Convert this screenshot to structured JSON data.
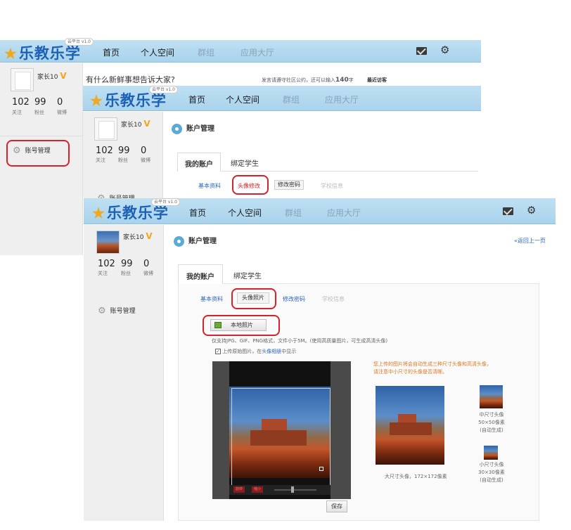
{
  "app": {
    "logo": "乐教乐学",
    "cloud_badge": "云平台 v1.0",
    "nav": [
      "首页",
      "个人空间",
      "群组",
      "应用大厅"
    ]
  },
  "user": {
    "name": "家长10",
    "vip": "V",
    "stats": [
      {
        "num": "102",
        "label": "关注"
      },
      {
        "num": "99",
        "label": "粉丝"
      },
      {
        "num": "0",
        "label": "微博"
      }
    ]
  },
  "sidebar_menu": {
    "account": "账号管理"
  },
  "layer1": {
    "status_prompt": "有什么新鲜事想告诉大家?",
    "status_notice_pre": "发言请遵守社区公约，还可以输入",
    "status_count": "140",
    "status_notice_post": "字",
    "recent_visitors": "最近访客"
  },
  "account": {
    "title": "账户管理",
    "back_link": "«返回上一页",
    "tabs": [
      "我的账户",
      "绑定学生"
    ],
    "subtabs": [
      "基本资料",
      "头像修改",
      "修改密码",
      "学校信息"
    ],
    "subtabs_final": [
      "基本资料",
      "头像照片",
      "修改密码",
      "学校信息"
    ]
  },
  "upload": {
    "local_photo": "本地照片",
    "format_hint": "仅支持JPG、GIF、PNG格式，文件小于5M。(使用高质量图片，可生成高清头像)",
    "save_original_pre": "上传原始图片，在",
    "save_original_link": "头像相册",
    "save_original_post": "中显示",
    "checkbox_checked": true,
    "notice_line1": "您上传的图片将会自动生成三种尺寸头像和高清头像，",
    "notice_line2": "请注意中小尺寸的头像是否清晰。",
    "large_caption": "大尺寸头像，172×172像素",
    "medium_caption_1": "中尺寸头像",
    "medium_caption_2": "50×50像素",
    "medium_caption_3": "(自动生成)",
    "small_caption_1": "小尺寸头像",
    "small_caption_2": "30×30像素",
    "small_caption_3": "(自动生成)",
    "crop_btn_1": "旋转",
    "crop_btn_2": "缩小",
    "save_button": "保存"
  },
  "colors": {
    "header_blue": "#a9d3ec",
    "highlight_red": "#d6222a",
    "link_blue": "#2b66b8",
    "vip_orange": "#f0a81c"
  }
}
